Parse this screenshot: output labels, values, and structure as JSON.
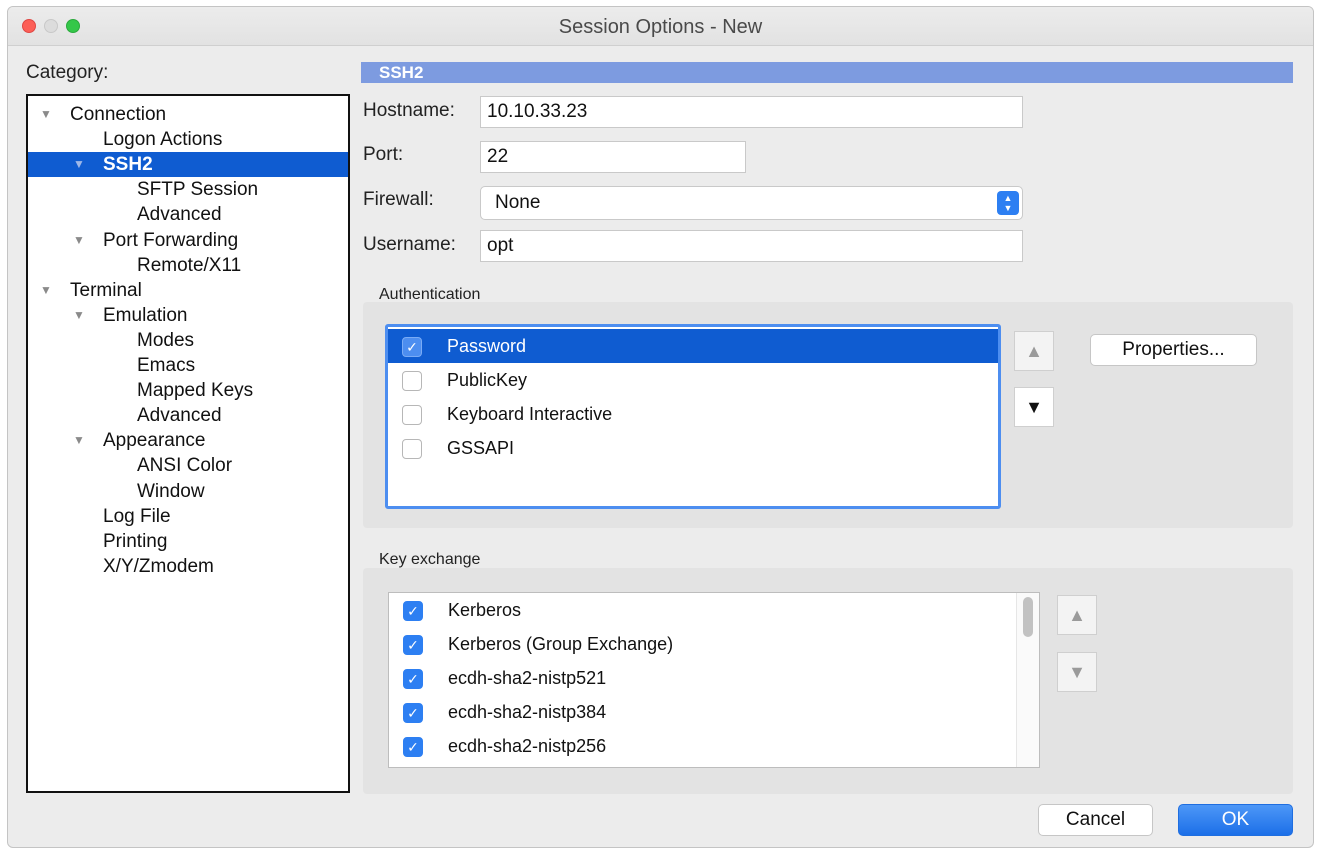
{
  "window": {
    "title": "Session Options - New"
  },
  "category": {
    "label": "Category:",
    "items": [
      {
        "label": "Connection",
        "arrow": "▼",
        "selected": false
      },
      {
        "label": "Logon Actions",
        "arrow": "",
        "selected": false
      },
      {
        "label": "SSH2",
        "arrow": "▼",
        "selected": true
      },
      {
        "label": "SFTP Session",
        "arrow": "",
        "selected": false
      },
      {
        "label": "Advanced",
        "arrow": "",
        "selected": false
      },
      {
        "label": "Port Forwarding",
        "arrow": "▼",
        "selected": false
      },
      {
        "label": "Remote/X11",
        "arrow": "",
        "selected": false
      },
      {
        "label": "Terminal",
        "arrow": "▼",
        "selected": false
      },
      {
        "label": "Emulation",
        "arrow": "▼",
        "selected": false
      },
      {
        "label": "Modes",
        "arrow": "",
        "selected": false
      },
      {
        "label": "Emacs",
        "arrow": "",
        "selected": false
      },
      {
        "label": "Mapped Keys",
        "arrow": "",
        "selected": false
      },
      {
        "label": "Advanced",
        "arrow": "",
        "selected": false
      },
      {
        "label": "Appearance",
        "arrow": "▼",
        "selected": false
      },
      {
        "label": "ANSI Color",
        "arrow": "",
        "selected": false
      },
      {
        "label": "Window",
        "arrow": "",
        "selected": false
      },
      {
        "label": "Log File",
        "arrow": "",
        "selected": false
      },
      {
        "label": "Printing",
        "arrow": "",
        "selected": false
      },
      {
        "label": "X/Y/Zmodem",
        "arrow": "",
        "selected": false
      }
    ]
  },
  "panel": {
    "header": "SSH2",
    "hostname": {
      "label": "Hostname:",
      "value": "10.10.33.23"
    },
    "port": {
      "label": "Port:",
      "value": "22"
    },
    "firewall": {
      "label": "Firewall:",
      "value": "None"
    },
    "username": {
      "label": "Username:",
      "value": "opt"
    }
  },
  "authentication": {
    "label": "Authentication",
    "items": [
      {
        "label": "Password",
        "checked": true,
        "selected": true
      },
      {
        "label": "PublicKey",
        "checked": false,
        "selected": false
      },
      {
        "label": "Keyboard Interactive",
        "checked": false,
        "selected": false
      },
      {
        "label": "GSSAPI",
        "checked": false,
        "selected": false
      }
    ],
    "properties_button": "Properties..."
  },
  "key_exchange": {
    "label": "Key exchange",
    "items": [
      {
        "label": "Kerberos",
        "checked": true
      },
      {
        "label": "Kerberos (Group Exchange)",
        "checked": true
      },
      {
        "label": "ecdh-sha2-nistp521",
        "checked": true
      },
      {
        "label": "ecdh-sha2-nistp384",
        "checked": true
      },
      {
        "label": "ecdh-sha2-nistp256",
        "checked": true
      }
    ]
  },
  "footer": {
    "cancel": "Cancel",
    "ok": "OK"
  },
  "icons": {
    "up": "▲",
    "down": "▼",
    "check": "✓"
  },
  "colors": {
    "accent": "#0f5cd1",
    "header_bar": "#7d9be0",
    "checkbox": "#2d7ff2"
  }
}
